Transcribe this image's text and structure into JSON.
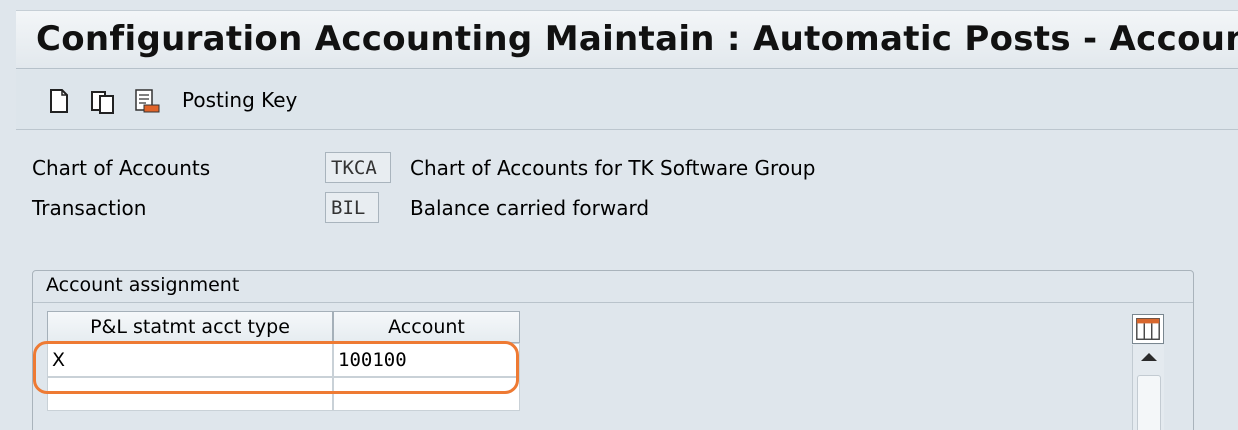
{
  "window": {
    "title": "Configuration Accounting Maintain : Automatic Posts - Accounts"
  },
  "toolbar": {
    "buttons": [
      {
        "icon": "new-document-icon"
      },
      {
        "icon": "copy-icon"
      },
      {
        "icon": "edit-document-icon"
      }
    ],
    "posting_key_label": "Posting Key"
  },
  "header_fields": {
    "chart_of_accounts": {
      "label": "Chart of Accounts",
      "value": "TKCA",
      "description": "Chart of Accounts for TK Software Group"
    },
    "transaction": {
      "label": "Transaction",
      "value": "BIL",
      "description": "Balance carried forward"
    }
  },
  "account_assignment": {
    "title": "Account assignment",
    "columns": [
      "P&L statmt acct type",
      "Account"
    ],
    "rows": [
      [
        "X",
        "100100"
      ],
      [
        "",
        ""
      ]
    ]
  },
  "colors": {
    "highlight": "#ee7a33",
    "background": "#dfe6ec"
  }
}
